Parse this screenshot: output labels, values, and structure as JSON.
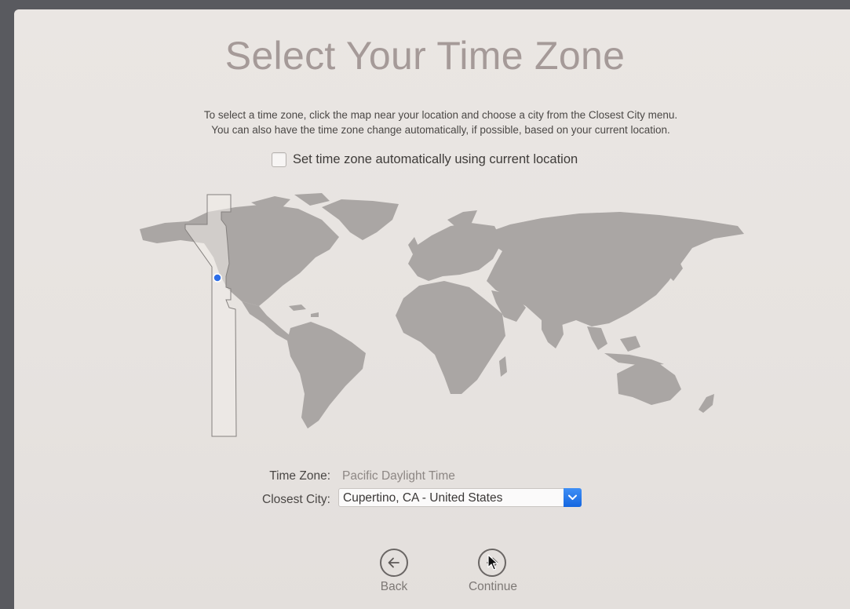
{
  "screen": {
    "title": "Select Your Time Zone",
    "description_line1": "To select a time zone, click the map near your location and choose a city from the Closest City menu.",
    "description_line2": "You can also have the time zone change automatically, if possible, based on your current location."
  },
  "auto_timezone": {
    "label": "Set time zone automatically using current location",
    "checked": false
  },
  "map": {
    "selected_marker_color": "#2d6ee8",
    "highlight_zone": "Pacific"
  },
  "time_zone": {
    "label": "Time Zone:",
    "value": "Pacific Daylight Time"
  },
  "closest_city": {
    "label": "Closest City:",
    "value": "Cupertino, CA - United States"
  },
  "nav": {
    "back_label": "Back",
    "continue_label": "Continue",
    "back_icon": "arrow-left-icon",
    "continue_icon": "arrow-right-icon"
  },
  "colors": {
    "background": "#e8e4e1",
    "land": "#aaa6a4",
    "title": "#a59a98",
    "accent": "#1466e0"
  }
}
